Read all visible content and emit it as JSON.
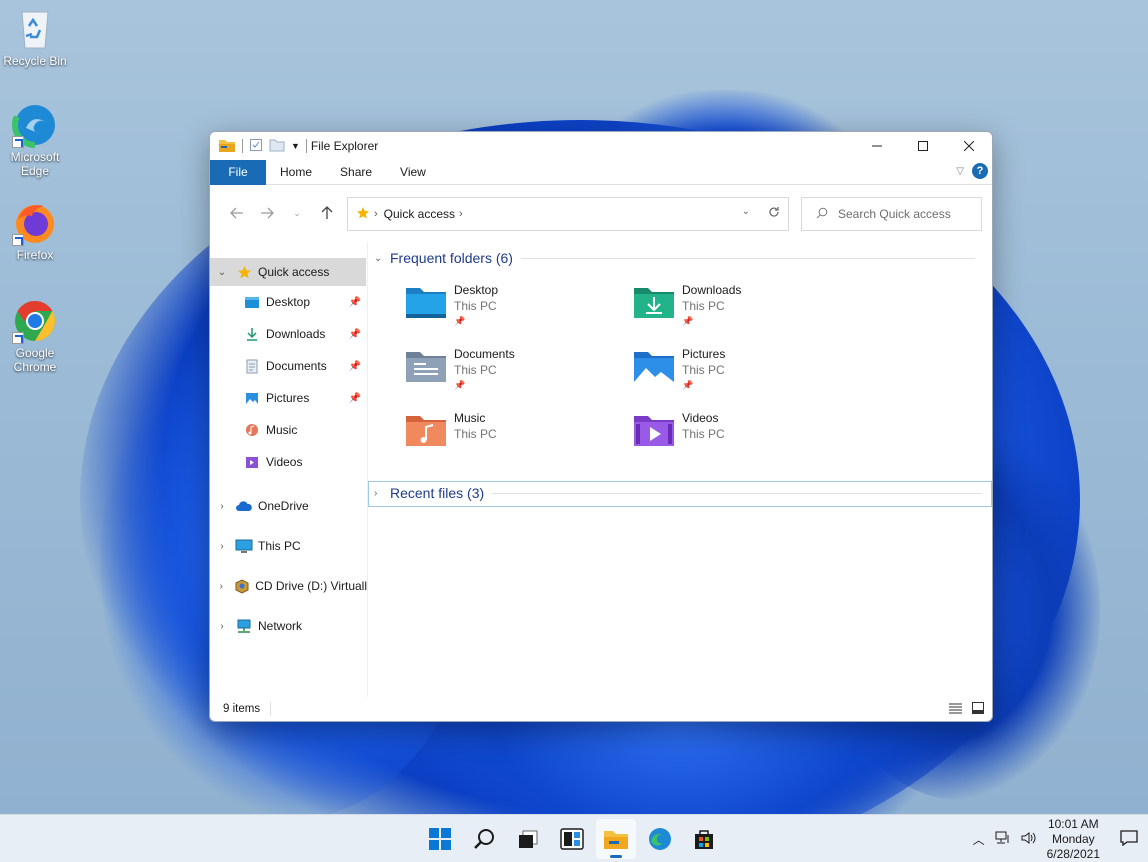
{
  "desktop": {
    "icons": [
      {
        "label": "Recycle Bin",
        "icon": "recycle-bin-icon"
      },
      {
        "label": "Microsoft Edge",
        "icon": "edge-icon"
      },
      {
        "label": "Firefox",
        "icon": "firefox-icon"
      },
      {
        "label": "Google Chrome",
        "icon": "chrome-icon"
      }
    ]
  },
  "window": {
    "title": "File Explorer",
    "ribbon_tabs": [
      "File",
      "Home",
      "Share",
      "View"
    ],
    "address": {
      "location": "Quick access"
    },
    "search": {
      "placeholder": "Search Quick access"
    },
    "nav_pane": {
      "quick_access": "Quick access",
      "pinned": [
        {
          "label": "Desktop",
          "pinned": true
        },
        {
          "label": "Downloads",
          "pinned": true
        },
        {
          "label": "Documents",
          "pinned": true
        },
        {
          "label": "Pictures",
          "pinned": true
        },
        {
          "label": "Music",
          "pinned": false
        },
        {
          "label": "Videos",
          "pinned": false
        }
      ],
      "roots": [
        {
          "label": "OneDrive"
        },
        {
          "label": "This PC"
        },
        {
          "label": "CD Drive (D:) Virtuall"
        },
        {
          "label": "Network"
        }
      ]
    },
    "groups": {
      "frequent": "Frequent folders (6)",
      "recent": "Recent files (3)"
    },
    "folders": [
      {
        "name": "Desktop",
        "location": "This PC",
        "pinned": true
      },
      {
        "name": "Downloads",
        "location": "This PC",
        "pinned": true
      },
      {
        "name": "Documents",
        "location": "This PC",
        "pinned": true
      },
      {
        "name": "Pictures",
        "location": "This PC",
        "pinned": true
      },
      {
        "name": "Music",
        "location": "This PC",
        "pinned": false
      },
      {
        "name": "Videos",
        "location": "This PC",
        "pinned": false
      }
    ],
    "status": {
      "items": "9 items"
    }
  },
  "taskbar": {
    "clock": {
      "time": "10:01 AM",
      "day": "Monday",
      "date": "6/28/2021"
    }
  },
  "colors": {
    "accent": "#1a6bb5",
    "group_header": "#1e3c8f"
  }
}
